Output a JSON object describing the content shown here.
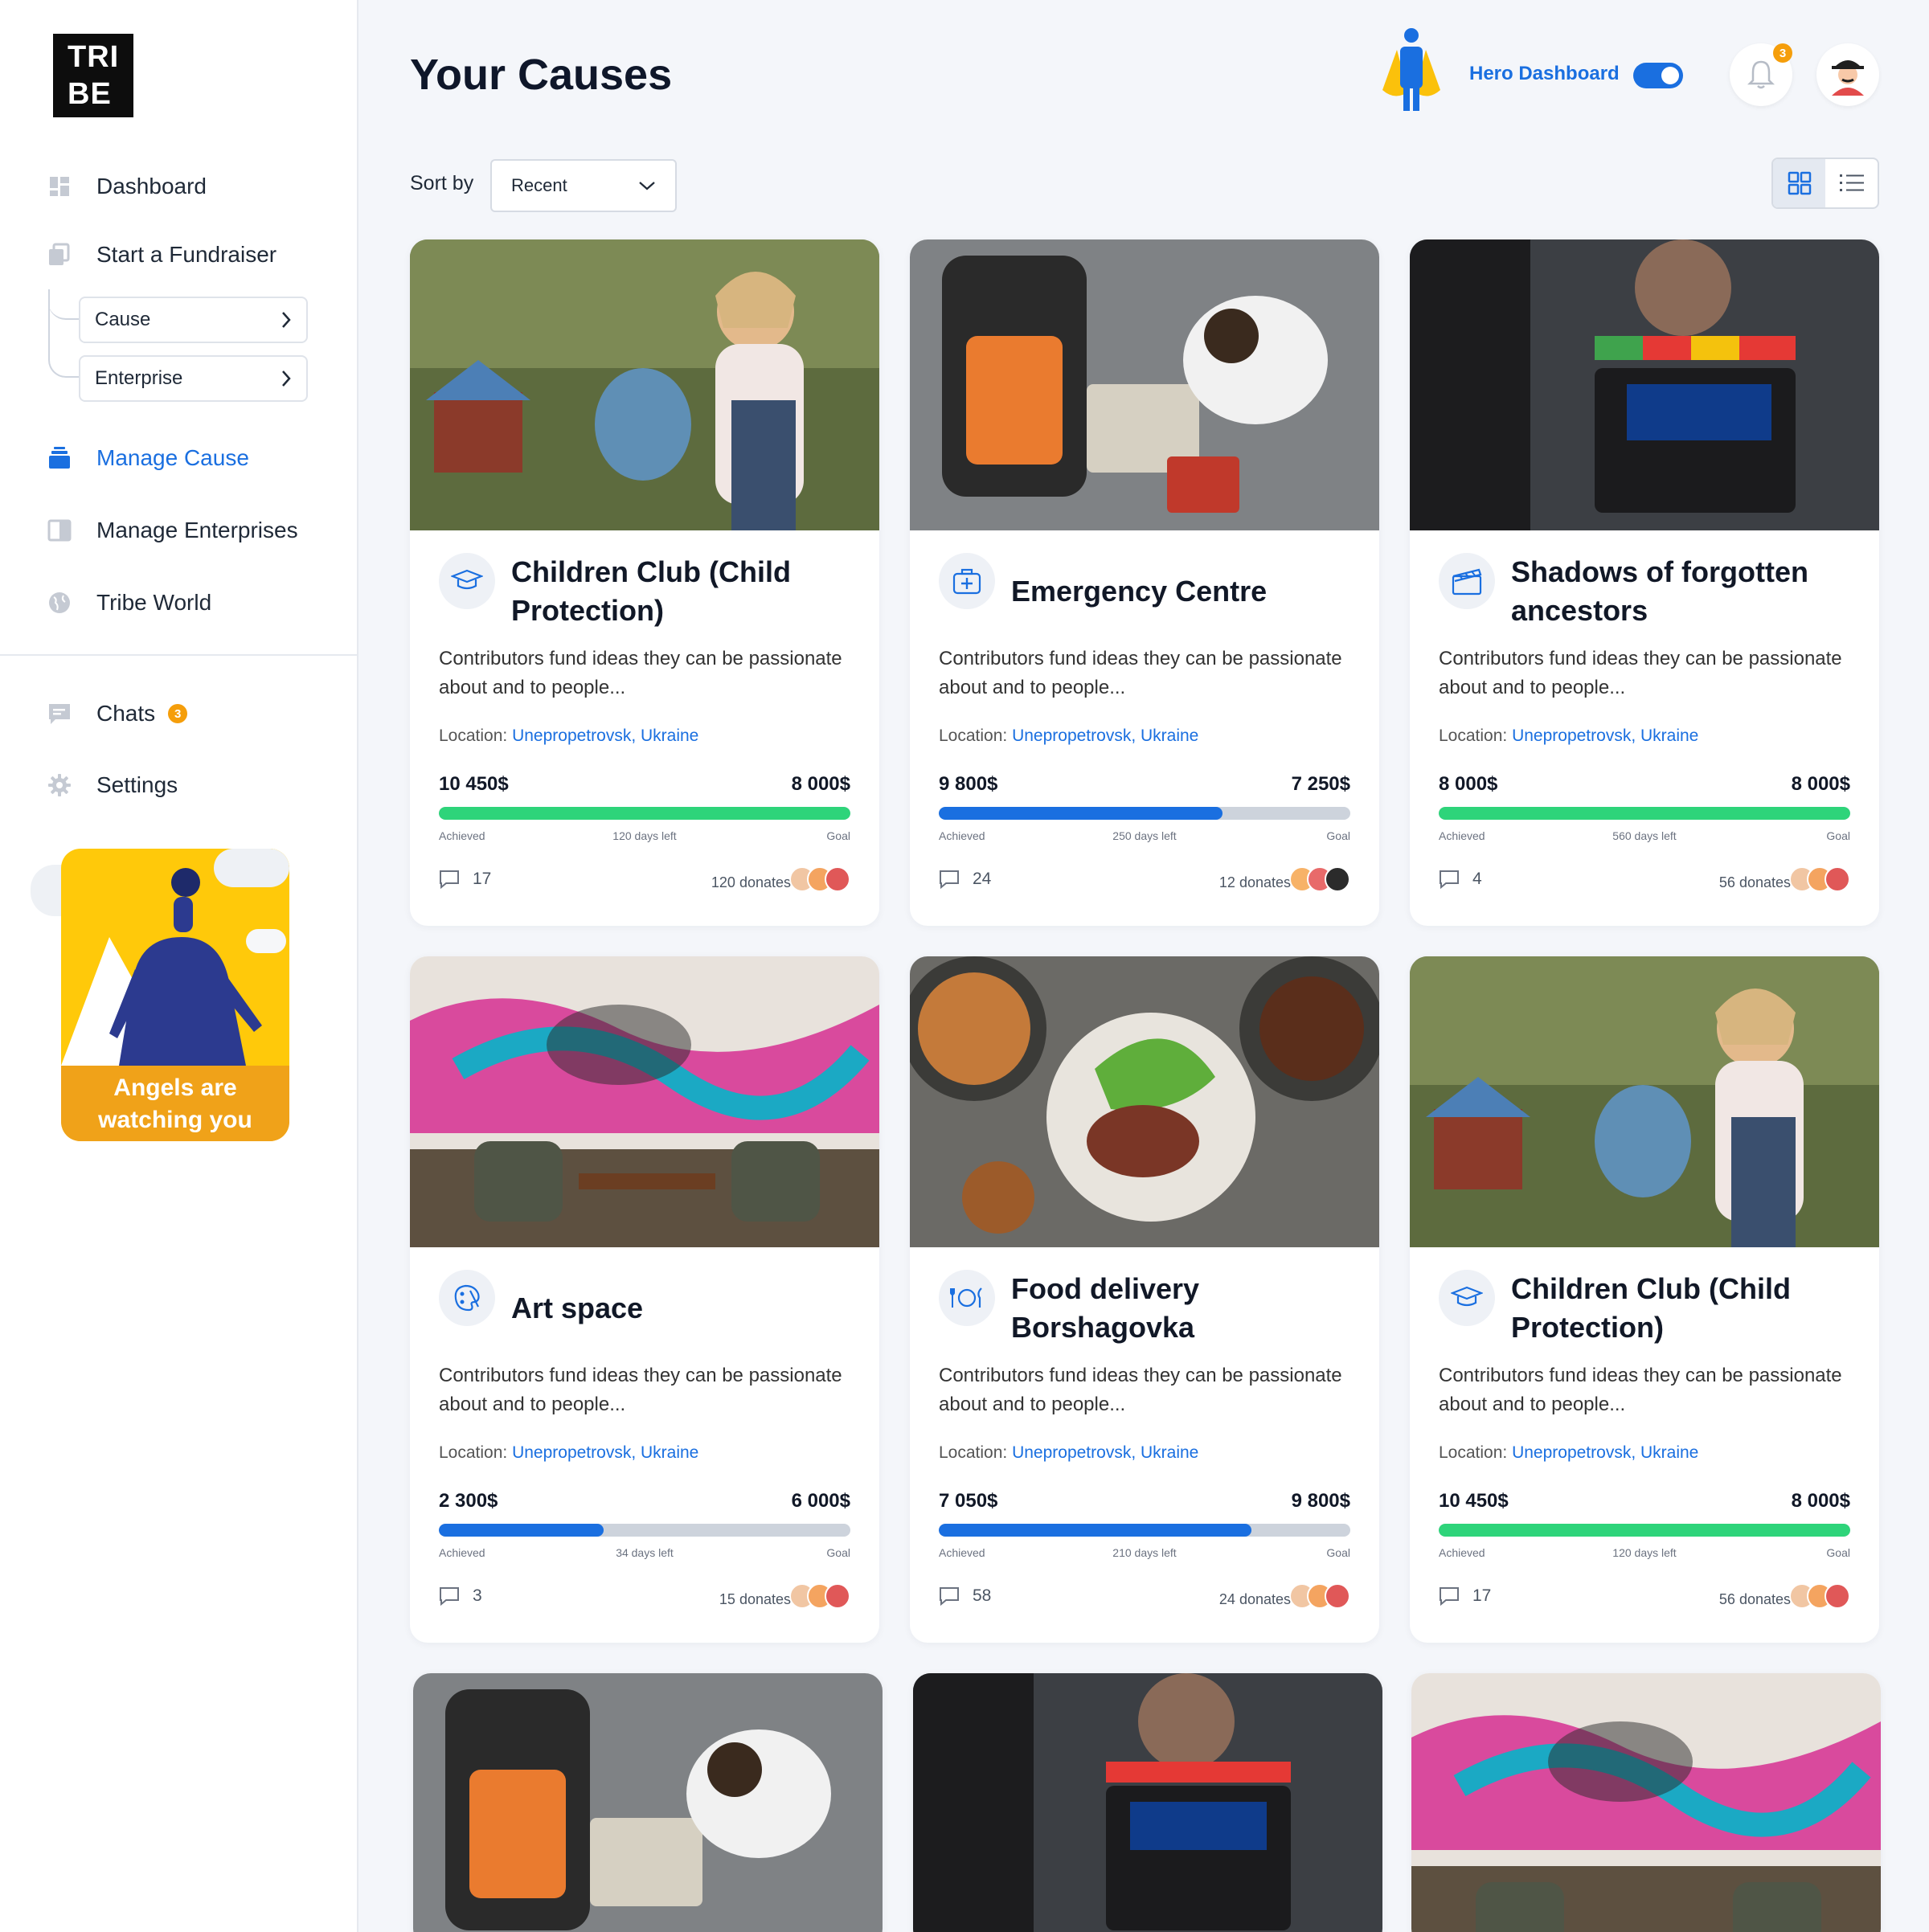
{
  "app": {
    "logo_line1": "TRI",
    "logo_line2": "BE",
    "page_title": "Your Causes"
  },
  "sidebar": {
    "items": [
      {
        "label": "Dashboard",
        "icon": "dashboard-icon"
      },
      {
        "label": "Start a Fundraiser",
        "icon": "fundraiser-icon"
      },
      {
        "label": "Manage Cause",
        "icon": "manage-cause-icon",
        "active": true
      },
      {
        "label": "Manage Enterprises",
        "icon": "enterprise-icon"
      },
      {
        "label": "Tribe World",
        "icon": "globe-icon"
      },
      {
        "label": "Chats",
        "icon": "chat-icon",
        "badge": "3"
      },
      {
        "label": "Settings",
        "icon": "gear-icon"
      }
    ],
    "sub_items": [
      "Cause",
      "Enterprise"
    ],
    "promo_text": "Angels are watching you"
  },
  "header": {
    "hero_label": "Hero Dashboard",
    "hero_toggle_on": true,
    "notification_count": "3"
  },
  "toolbar": {
    "sort_label": "Sort by",
    "sort_value": "Recent",
    "view_mode": "grid"
  },
  "colors": {
    "accent": "#1a6fe0",
    "success": "#2ed47a",
    "badge": "#f59e0b"
  },
  "cards": [
    {
      "title": "Children Club (Child Protection)",
      "icon": "graduation-cap-icon",
      "desc": "Contributors fund ideas they can be passionate about and to people...",
      "loc_label": "Location:",
      "loc": "Unepropetrovsk, Ukraine",
      "achieved": "10 450$",
      "goal": "8 000$",
      "progress": 1.0,
      "bar_color": "green",
      "achieved_label": "Achieved",
      "days": "120 days left",
      "goal_label": "Goal",
      "comments": "17",
      "donates": "120 donates"
    },
    {
      "title": "Emergency Centre",
      "icon": "medical-kit-icon",
      "desc": "Contributors fund ideas they can be passionate about and to people...",
      "loc_label": "Location:",
      "loc": "Unepropetrovsk, Ukraine",
      "achieved": "9 800$",
      "goal": "7 250$",
      "progress": 0.69,
      "bar_color": "blue",
      "achieved_label": "Achieved",
      "days": "250 days left",
      "goal_label": "Goal",
      "comments": "24",
      "donates": "12 donates"
    },
    {
      "title": "Shadows of forgotten ancestors",
      "icon": "clapperboard-icon",
      "desc": "Contributors fund ideas they can be passionate about and to people...",
      "loc_label": "Location:",
      "loc": "Unepropetrovsk, Ukraine",
      "achieved": "8 000$",
      "goal": "8 000$",
      "progress": 1.0,
      "bar_color": "green",
      "achieved_label": "Achieved",
      "days": "560 days left",
      "goal_label": "Goal",
      "comments": "4",
      "donates": "56 donates"
    },
    {
      "title": "Art space",
      "icon": "palette-icon",
      "desc": "Contributors fund ideas they can be passionate about and to people...",
      "loc_label": "Location:",
      "loc": "Unepropetrovsk, Ukraine",
      "achieved": "2 300$",
      "goal": "6 000$",
      "progress": 0.4,
      "bar_color": "blue",
      "achieved_label": "Achieved",
      "days": "34 days left",
      "goal_label": "Goal",
      "comments": "3",
      "donates": "15 donates"
    },
    {
      "title": "Food delivery Borshagovka",
      "icon": "cutlery-icon",
      "desc": "Contributors fund ideas they can be passionate about and to people...",
      "loc_label": "Location:",
      "loc": "Unepropetrovsk, Ukraine",
      "achieved": "7 050$",
      "goal": "9 800$",
      "progress": 0.76,
      "bar_color": "blue",
      "achieved_label": "Achieved",
      "days": "210 days left",
      "goal_label": "Goal",
      "comments": "58",
      "donates": "24 donates"
    },
    {
      "title": "Children Club (Child Protection)",
      "icon": "graduation-cap-icon",
      "desc": "Contributors fund ideas they can be passionate about and to people...",
      "loc_label": "Location:",
      "loc": "Unepropetrovsk, Ukraine",
      "achieved": "10 450$",
      "goal": "8 000$",
      "progress": 1.0,
      "bar_color": "green",
      "achieved_label": "Achieved",
      "days": "120 days left",
      "goal_label": "Goal",
      "comments": "17",
      "donates": "56 donates"
    }
  ]
}
